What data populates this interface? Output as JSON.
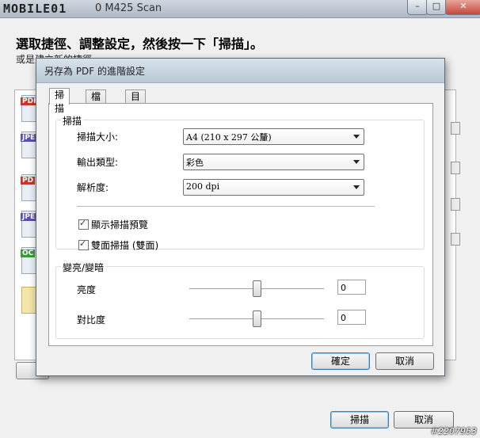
{
  "main_window": {
    "watermark_logo": "MOBILE01",
    "title": "0 M425 Scan",
    "instruction": "選取捷徑、調整設定，然後按一下「掃描」。",
    "subtext": "或是建立新的捷徑。",
    "file_tags": [
      "PDF",
      "JPE",
      "PD",
      "JPE",
      "OC"
    ],
    "scan_button": "掃描",
    "cancel_button": "取消",
    "corner_id": "#2207953",
    "window_controls": {
      "minimize": "–",
      "maximize": "□",
      "close": "✕"
    }
  },
  "dialog": {
    "title": "另存為 PDF 的進階設定",
    "tabs": [
      "掃描",
      "檔案",
      "目的地"
    ],
    "active_tab": "掃描",
    "scan_group": {
      "title": "掃描",
      "fields": [
        {
          "label": "掃描大小:",
          "value": "A4 (210 x 297 公釐)"
        },
        {
          "label": "輸出類型:",
          "value": "彩色"
        },
        {
          "label": "解析度:",
          "value": "200 dpi"
        }
      ],
      "checkboxes": [
        {
          "label": "顯示掃描預覽",
          "checked": true
        },
        {
          "label": "雙面掃描 (雙面)",
          "checked": true
        }
      ]
    },
    "brightness_group": {
      "title": "變亮/變暗",
      "sliders": [
        {
          "label": "亮度",
          "value": "0",
          "position_fraction": 0.5
        },
        {
          "label": "對比度",
          "value": "0",
          "position_fraction": 0.5
        }
      ]
    },
    "ok_button": "確定",
    "cancel_button": "取消"
  },
  "colors": {
    "dialog_title_bar": "#c8d5e2",
    "pdf_tag": "#c0392b",
    "jpe_tag": "#5b4fa8",
    "oc_tag": "#3a9a3a"
  }
}
